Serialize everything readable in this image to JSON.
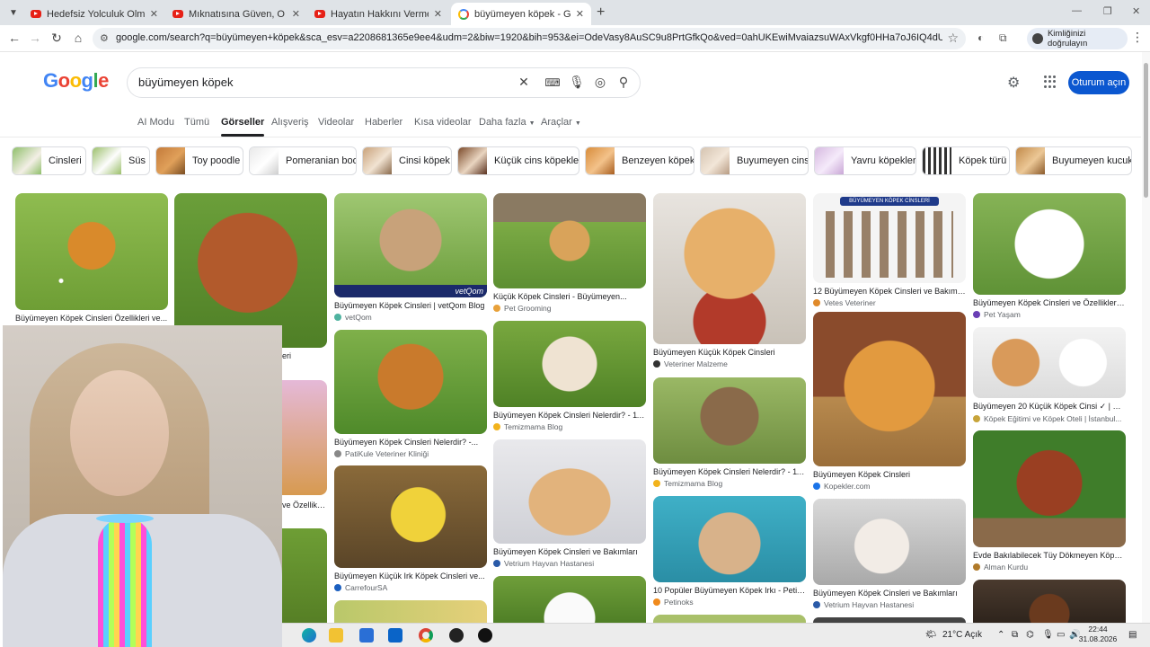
{
  "browser": {
    "tabs": [
      {
        "title": "Hedefsiz Yolculuk Olmaz | Polat",
        "favicon": "youtube-icon"
      },
      {
        "title": "Mıknatısına Güven, O Seni Hed",
        "favicon": "youtube-icon"
      },
      {
        "title": "Hayatın Hakkını Vermek | Acar",
        "favicon": "youtube-icon"
      },
      {
        "title": "büyümeyen köpek - Google'da",
        "favicon": "google-icon"
      }
    ],
    "new_tab": "+",
    "url": "google.com/search?q=büyümeyen+köpek&sca_esv=a2208681365e9ee4&udm=2&biw=1920&bih=953&ei=OdeVasy8AuSC9u8PrtGfkQo&ved=0ahUKEwiMvaiazsuWAxVkgf0HHa7oJ6IQ4dUDCBE&uact=5&oq=büyümeyen...",
    "profile_label": "Kimliğinizi doğrulayın"
  },
  "google": {
    "logo": [
      "G",
      "o",
      "o",
      "g",
      "l",
      "e"
    ],
    "logo_colors": [
      "#4285f4",
      "#ea4335",
      "#fbbc05",
      "#4285f4",
      "#34a853",
      "#ea4335"
    ],
    "query": "büyümeyen köpek",
    "signin": "Oturum açın",
    "tabs": [
      "AI Modu",
      "Tümü",
      "Görseller",
      "Alışveriş",
      "Videolar",
      "Haberler",
      "Kısa videolar",
      "Daha fazla",
      "Araçlar"
    ],
    "chips": [
      "Cinsleri",
      "Süs",
      "Toy poodle",
      "Pomeranian boo",
      "Cinsi köpek",
      "Küçük cins köpekler",
      "Benzeyen köpek",
      "Buyumeyen cins",
      "Yavru köpekler",
      "Köpek türü",
      "Buyumeyen kucuk"
    ]
  },
  "results": [
    {
      "title": "Büyümeyen Köpek Cinsleri Özellikleri ve...",
      "source": ""
    },
    {
      "title": "eri",
      "source": ""
    },
    {
      "title": "Büyümeyen Köpek Cinsleri | vetQom Blog",
      "source": "vetQom",
      "watermark": "vetQom"
    },
    {
      "title": "Küçük Köpek Cinsleri - Büyümeyen...",
      "source": "Pet Grooming"
    },
    {
      "title": "Büyümeyen Küçük Köpek Cinsleri",
      "source": "Veteriner Malzeme"
    },
    {
      "title": "12 Büyümeyen Köpek Cinsleri ve Bakımları...",
      "source": "Vetes Veteriner",
      "banner": "BÜYÜMEYEN KÖPEK CİNSLERİ"
    },
    {
      "title": "Büyümeyen Köpek Cinsleri ve Özellikleri -...",
      "source": "Pet Yaşam"
    },
    {
      "title": "Büyümeyen Köpek Cinsleri Nelerdir? -...",
      "source": "PatiKule Veteriner Kliniği"
    },
    {
      "title": "Büyümeyen Köpek Cinsleri Nelerdir? - 11...",
      "source": "Temizmama Blog"
    },
    {
      "title": "Büyümeyen Köpek Cinsleri Nelerdir? - 11...",
      "source": "Temizmama Blog"
    },
    {
      "title": "Büyümeyen Köpek Cinsleri",
      "source": "Kopekler.com"
    },
    {
      "title": "Büyümeyen 20 Küçük Köpek Cinsi ✓ | Pet...",
      "source": "Köpek Eğitimi ve Köpek Oteli | İstanbul..."
    },
    {
      "title": "ve Özellikle...",
      "source": ""
    },
    {
      "title": "Büyümeyen Küçük Irk Köpek Cinsleri ve...",
      "source": "CarrefourSA"
    },
    {
      "title": "Büyümeyen Köpek Cinsleri ve Bakımları",
      "source": "Vetrium Hayvan Hastanesi"
    },
    {
      "title": "10 Popüler Büyümeyen Köpek Irkı - Petinoks",
      "source": "Petinoks"
    },
    {
      "title": "Büyümeyen Köpek Cinsleri ve Bakımları",
      "source": "Vetrium Hayvan Hastanesi"
    },
    {
      "title": "Evde Bakılabilecek Tüy Dökmeyen Köpek...",
      "source": "Alman Kurdu"
    }
  ],
  "taskbar": {
    "weather": "21°C  Açık",
    "time": "22:44",
    "date": "31.08.2026"
  }
}
